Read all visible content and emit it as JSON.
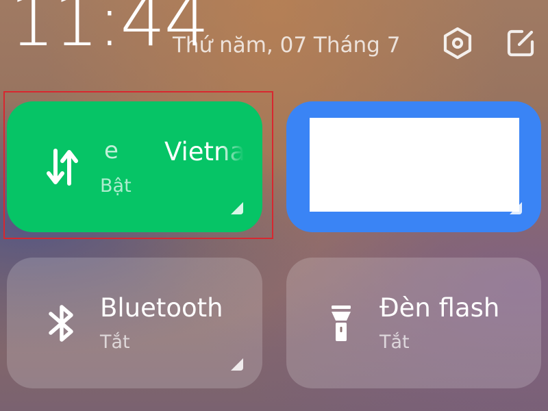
{
  "status": {
    "time": "11:44",
    "date": "Thứ năm, 07 Tháng 7"
  },
  "header_icons": [
    "settings-icon",
    "edit-icon"
  ],
  "tiles": {
    "mobile_data": {
      "label_part_a": "e",
      "label_part_b": "Vietna",
      "status": "Bật",
      "icon": "mobile-data-arrows-icon",
      "color": "#06c466"
    },
    "wifi": {
      "color": "#3a84f5"
    },
    "bluetooth": {
      "title": "Bluetooth",
      "status": "Tắt",
      "icon": "bluetooth-icon"
    },
    "flashlight": {
      "title": "Đèn flash",
      "status": "Tắt",
      "icon": "flashlight-icon"
    }
  },
  "highlight_color": "#d8272f"
}
